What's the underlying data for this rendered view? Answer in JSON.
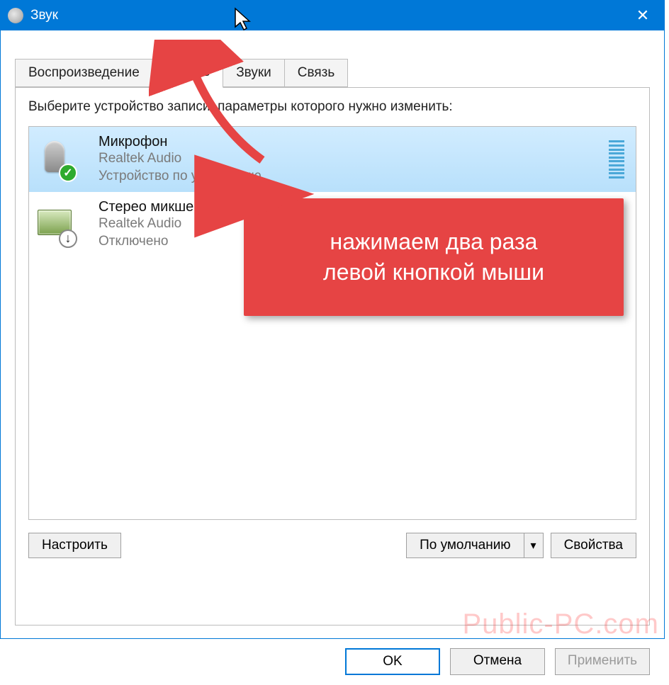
{
  "window": {
    "title": "Звук",
    "close_label": "✕"
  },
  "tabs": [
    {
      "label": "Воспроизведение",
      "active": false
    },
    {
      "label": "Запись",
      "active": true
    },
    {
      "label": "Звуки",
      "active": false
    },
    {
      "label": "Связь",
      "active": false
    }
  ],
  "instruction": "Выберите устройство записи, параметры которого нужно изменить:",
  "devices": [
    {
      "name": "Микрофон",
      "subtitle": "Realtek Audio",
      "status": "Устройство по умолчанию",
      "badge": "ok",
      "selected": true,
      "icon": "mic"
    },
    {
      "name": "Стерео микшер",
      "subtitle": "Realtek Audio",
      "status": "Отключено",
      "badge": "off",
      "selected": false,
      "icon": "card"
    }
  ],
  "buttons": {
    "configure": "Настроить",
    "set_default": "По умолчанию",
    "properties": "Свойства",
    "ok": "OK",
    "cancel": "Отмена",
    "apply": "Применить"
  },
  "annotation": {
    "callout_line1": "нажимаем два раза",
    "callout_line2": "левой кнопкой мыши"
  },
  "watermark": "Public-PC.com"
}
